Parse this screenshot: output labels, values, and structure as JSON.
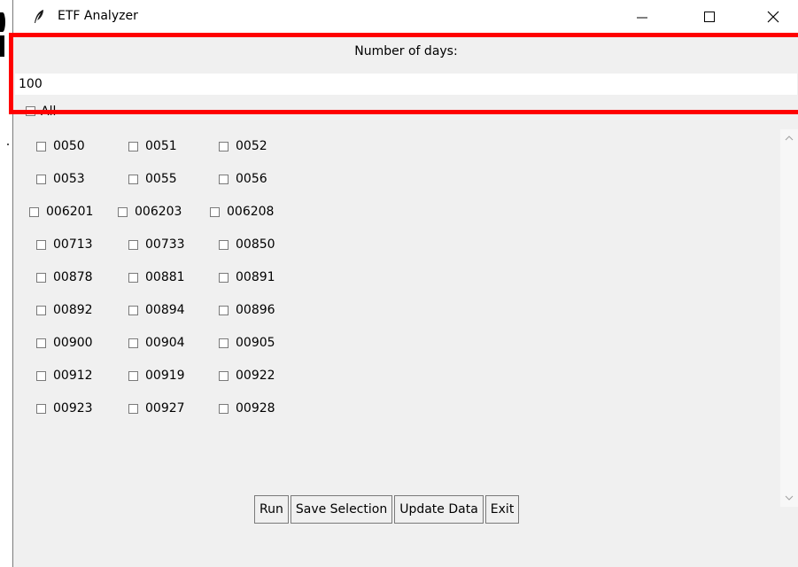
{
  "window": {
    "title": "ETF Analyzer"
  },
  "days": {
    "label": "Number of days:",
    "value": "100"
  },
  "all": {
    "label": "All",
    "checked": false
  },
  "etfs": [
    [
      "0050",
      "0051",
      "0052"
    ],
    [
      "0053",
      "0055",
      "0056"
    ],
    [
      "006201",
      "006203",
      "006208"
    ],
    [
      "00713",
      "00733",
      "00850"
    ],
    [
      "00878",
      "00881",
      "00891"
    ],
    [
      "00892",
      "00894",
      "00896"
    ],
    [
      "00900",
      "00904",
      "00905"
    ],
    [
      "00912",
      "00919",
      "00922"
    ],
    [
      "00923",
      "00927",
      "00928"
    ]
  ],
  "buttons": {
    "run": "Run",
    "save": "Save Selection",
    "update": "Update Data",
    "exit": "Exit"
  },
  "colors": {
    "highlight": "#ff0000"
  },
  "icons": {
    "app": "feather-icon",
    "minimize": "minimize-icon",
    "maximize": "maximize-icon",
    "close": "close-icon"
  }
}
